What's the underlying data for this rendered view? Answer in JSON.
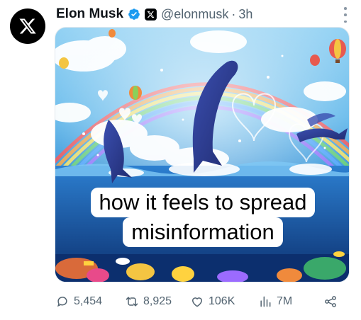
{
  "tweet": {
    "author_name": "Elon Musk",
    "handle": "@elonmusk",
    "separator": "·",
    "time": "3h",
    "affiliation_icon": "x-logo-icon",
    "verified_icon": "verified-badge-icon",
    "avatar_icon": "x-logo-icon"
  },
  "media": {
    "caption_line1": "how it feels to spread",
    "caption_line2": "misinformation"
  },
  "actions": {
    "replies": "5,454",
    "reposts": "8,925",
    "likes": "106K",
    "views": "7M"
  },
  "colors": {
    "verified": "#1d9bf0",
    "muted": "#536471",
    "text": "#0f1419"
  }
}
